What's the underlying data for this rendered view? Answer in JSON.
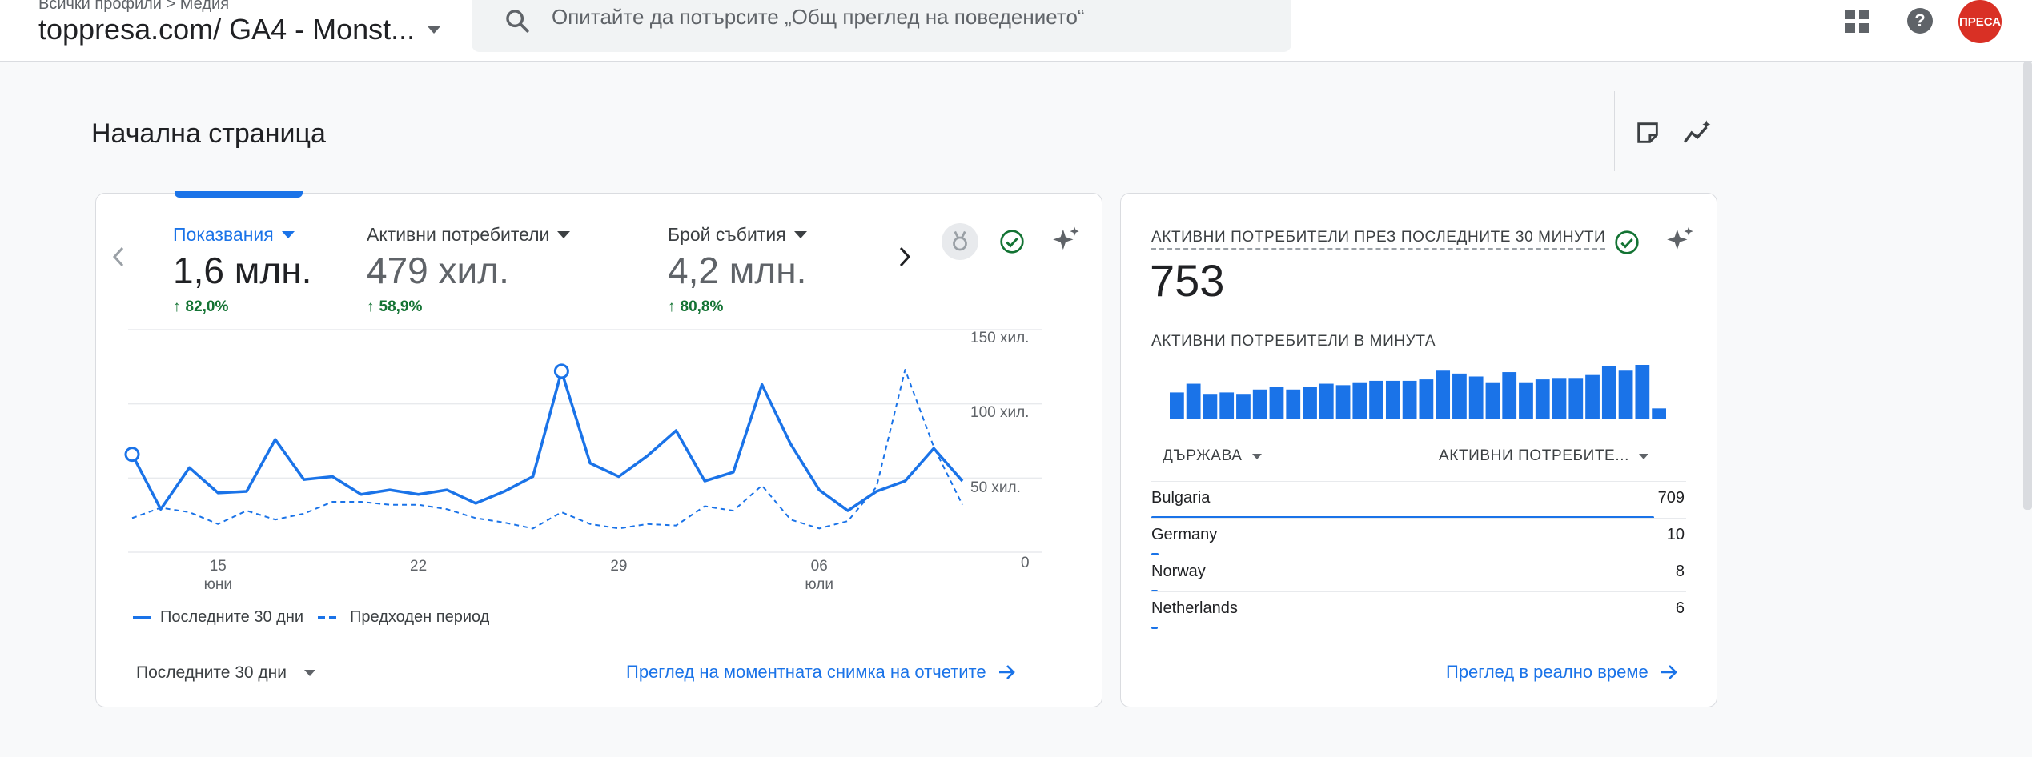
{
  "header": {
    "breadcrumb_all": "Всички профили",
    "breadcrumb_sep": ">",
    "breadcrumb_media": "Медия",
    "property_name": "toppresa.com/ GA4 - Monst...",
    "search_placeholder": "Опитайте да потърсите „Общ преглед на поведението“",
    "avatar_text": "ПРЕСА"
  },
  "page": {
    "title": "Начална страница"
  },
  "metrics": [
    {
      "label": "Показвания",
      "value": "1,6 млн.",
      "change": "82,0%"
    },
    {
      "label": "Активни потребители",
      "value": "479 хил.",
      "change": "58,9%"
    },
    {
      "label": "Брой събития",
      "value": "4,2 млн.",
      "change": "80,8%"
    }
  ],
  "chart_data": {
    "type": "line",
    "y_ticks": [
      "150 хил.",
      "100 хил.",
      "50 хил.",
      "0"
    ],
    "ylim": [
      0,
      150000
    ],
    "x_ticks": [
      {
        "index": 3,
        "label": "15",
        "sublabel": "юни"
      },
      {
        "index": 10,
        "label": "22",
        "sublabel": ""
      },
      {
        "index": 17,
        "label": "29",
        "sublabel": ""
      },
      {
        "index": 24,
        "label": "06",
        "sublabel": "юли"
      }
    ],
    "series": [
      {
        "name": "Последните 30 дни",
        "style": "solid",
        "color": "#1a73e8",
        "values": [
          66000,
          29000,
          57000,
          40000,
          41000,
          76000,
          49000,
          51000,
          39000,
          42000,
          39000,
          42000,
          33000,
          41000,
          51000,
          122000,
          60000,
          51000,
          65000,
          82000,
          48000,
          54000,
          113000,
          73000,
          42000,
          28000,
          41000,
          48000,
          70000,
          48000
        ]
      },
      {
        "name": "Предходен период",
        "style": "dashed",
        "color": "#1a73e8",
        "values": [
          23000,
          30000,
          27000,
          19000,
          28000,
          22000,
          26000,
          34000,
          34000,
          32000,
          32000,
          29000,
          23000,
          20000,
          16000,
          27000,
          19000,
          16000,
          19000,
          18000,
          31000,
          28000,
          45000,
          22000,
          16000,
          21000,
          44000,
          123000,
          71000,
          32000
        ]
      }
    ]
  },
  "card1": {
    "date_range": "Последните 30 дни",
    "snapshot_link": "Преглед на моментната снимка на отчетите"
  },
  "realtime": {
    "title": "АКТИВНИ ПОТРЕБИТЕЛИ ПРЕЗ ПОСЛЕДНИТЕ 30 МИНУТИ",
    "total": "753",
    "per_minute_label": "АКТИВНИ ПОТРЕБИТЕЛИ В МИНУТА",
    "per_minute_values": [
      18,
      24,
      17,
      18,
      17,
      20,
      22,
      20,
      22,
      24,
      23,
      25,
      26,
      26,
      26,
      27,
      33,
      31,
      29,
      25,
      32,
      25,
      27,
      28,
      28,
      30,
      36,
      33,
      37,
      7
    ],
    "col_country": "ДЪРЖАВА",
    "col_users": "АКТИВНИ ПОТРЕБИТЕ...",
    "rows": [
      {
        "country": "Bulgaria",
        "users": "709",
        "share": 0.94
      },
      {
        "country": "Germany",
        "users": "10",
        "share": 0.013
      },
      {
        "country": "Norway",
        "users": "8",
        "share": 0.011
      },
      {
        "country": "Netherlands",
        "users": "6",
        "share": 0.008
      }
    ],
    "realtime_link": "Преглед в реално време"
  },
  "colors": {
    "accent": "#1a73e8",
    "positive": "#137333",
    "avatar": "#d93025"
  }
}
